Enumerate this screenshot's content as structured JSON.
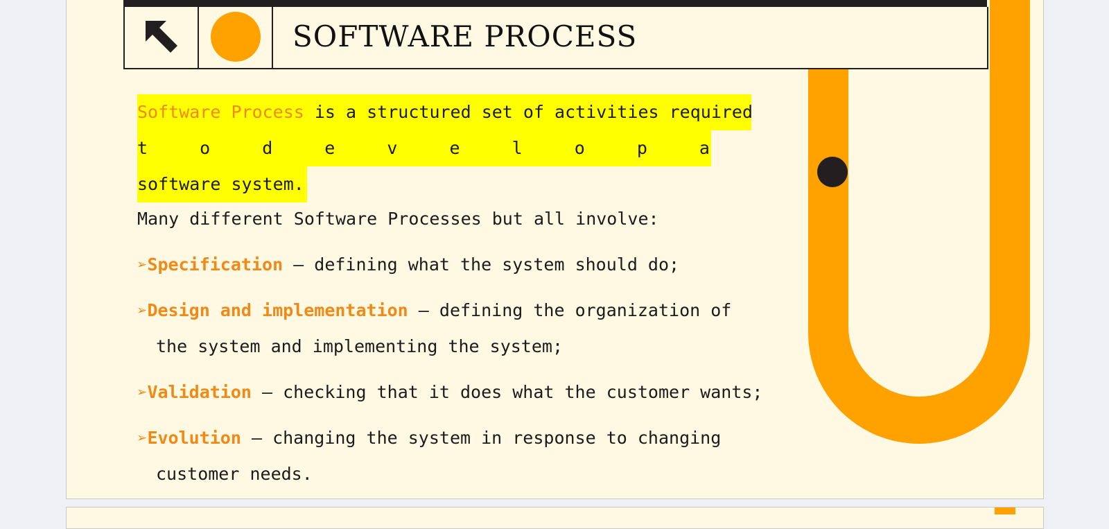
{
  "slide": {
    "title": "SOFTWARE PROCESS",
    "intro": {
      "term": "Software Process",
      "line1_rest": " is a structured set of activities required",
      "line2": "t o  d e v e l o p  a",
      "line3": "software system."
    },
    "many": "Many different Software Processes but all involve:",
    "bullets": [
      {
        "term": "Specification",
        "dash": " – ",
        "desc": "defining what the system should do;",
        "cont": ""
      },
      {
        "term": "Design and implementation",
        "dash": " – ",
        "desc": "defining the organization of",
        "cont": "the system and implementing the system;"
      },
      {
        "term": "Validation",
        "dash": " – ",
        "desc": "checking that it does what the customer wants;",
        "cont": ""
      },
      {
        "term": "Evolution",
        "dash": " – ",
        "desc": "changing the system in response to changing",
        "cont": "customer needs."
      }
    ],
    "bullet_glyph": "➢"
  },
  "icons": {
    "arrow": "arrow-up-left-icon",
    "circle": "orange-circle-icon",
    "u_shape": "u-shape-decoration-icon"
  },
  "colors": {
    "accent": "#ffa200",
    "term": "#f08a17",
    "highlight": "#ffff00",
    "dark": "#231f20",
    "background": "#fff9e3"
  }
}
